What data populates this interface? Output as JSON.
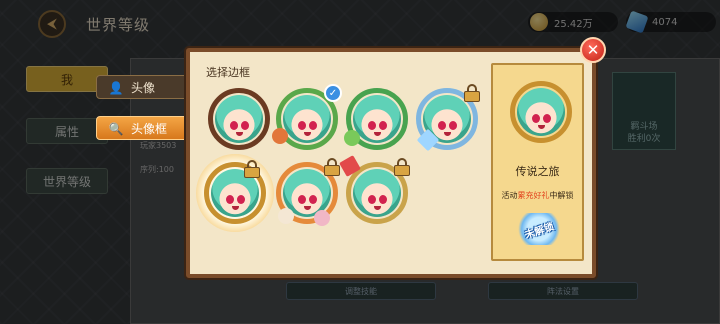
{
  "topbar": {
    "title": "世界等级",
    "gold": "25.42万",
    "gems": "4074"
  },
  "left_tabs": [
    "我",
    "属性",
    "世界等级"
  ],
  "background": {
    "player_text": "玩家3503",
    "order_text": "序列:100",
    "card_text_1": "羁斗场",
    "card_text_2": "胜利0次",
    "bottom_left": "调整技能",
    "bottom_right": "阵法设置"
  },
  "side_tabs": {
    "avatar": "头像",
    "frame": "头像框"
  },
  "modal": {
    "title": "选择边框",
    "close_icon": "close-icon",
    "frames": [
      {
        "style": "plain-brown",
        "state": "default",
        "ring_color": "#6b3b22"
      },
      {
        "style": "mushroom",
        "state": "equipped",
        "ring_color": "#5aa84a"
      },
      {
        "style": "clover",
        "state": "unlocked",
        "ring_color": "#48a34f"
      },
      {
        "style": "crystal",
        "state": "locked",
        "ring_color": "#7fb6e0"
      },
      {
        "style": "legend-journey",
        "state": "locked-selected",
        "ring_color": "#c7902f"
      },
      {
        "style": "cute-pets",
        "state": "locked",
        "ring_color": "#e58a3a"
      },
      {
        "style": "party",
        "state": "locked",
        "ring_color": "#c9a34a"
      }
    ]
  },
  "preview": {
    "name": "传说之旅",
    "unlock_prefix": "活动",
    "unlock_highlight": "累充好礼",
    "unlock_suffix": "中解锁",
    "badge": "未解锁"
  }
}
